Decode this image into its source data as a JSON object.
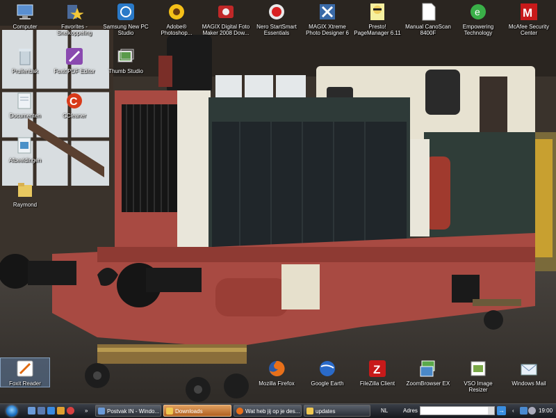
{
  "desktop_icons": [
    {
      "label": "Computer",
      "icon": "computer-icon"
    },
    {
      "label": "Favorites - Snelkoppeling",
      "icon": "favorites-star-icon"
    },
    {
      "label": "Samsung New PC Studio",
      "icon": "samsung-pc-studio-icon"
    },
    {
      "label": "Adobe® Photoshop...",
      "icon": "photoshop-sunflower-icon"
    },
    {
      "label": "MAGIX Digital Foto Maker 2008 Dow...",
      "icon": "magix-foto-maker-icon"
    },
    {
      "label": "Nero StartSmart Essentials",
      "icon": "nero-icon"
    },
    {
      "label": "MAGIX Xtreme Photo Designer 6",
      "icon": "magix-photo-designer-icon"
    },
    {
      "label": "Presto! PageManager 6.11",
      "icon": "presto-pagemanager-icon"
    },
    {
      "label": "Manual CanoScan 8400F",
      "icon": "document-icon"
    },
    {
      "label": "Empowering Technology",
      "icon": "empowering-technology-icon"
    },
    {
      "label": "McAfee Security Center",
      "icon": "mcafee-icon"
    },
    {
      "label": "Prullenbak",
      "icon": "recycle-bin-icon"
    },
    {
      "label": "Foxit PDF Editor",
      "icon": "foxit-pdf-editor-icon"
    },
    {
      "label": "Thumb Studio",
      "icon": "thumb-studio-icon"
    },
    {
      "label": "Documenten",
      "icon": "documents-folder-icon"
    },
    {
      "label": "CCleaner",
      "icon": "ccleaner-icon"
    },
    {
      "label": "Afbeeldingen",
      "icon": "pictures-folder-icon"
    },
    {
      "label": "Raymond",
      "icon": "user-folder-icon"
    },
    {
      "label": "Foxit Reader",
      "icon": "foxit-reader-icon"
    },
    {
      "label": "Mozilla Firefox",
      "icon": "firefox-icon"
    },
    {
      "label": "Google Earth",
      "icon": "google-earth-icon"
    },
    {
      "label": "FileZilla Client",
      "icon": "filezilla-icon"
    },
    {
      "label": "ZoomBrowser EX",
      "icon": "zoombrowser-icon"
    },
    {
      "label": "VSO Image Resizer",
      "icon": "vso-image-resizer-icon"
    },
    {
      "label": "Windows Mail",
      "icon": "windows-mail-icon"
    }
  ],
  "taskbar": {
    "quick_launch": [
      "show-desktop-icon",
      "switch-windows-icon",
      "ie-icon",
      "media-player-icon",
      "mail-icon",
      "firefox-icon"
    ],
    "overflow": "»",
    "buttons": [
      {
        "label": "Postvak IN - Windo...",
        "active": false
      },
      {
        "label": "Downloads",
        "active": true
      },
      {
        "label": "Wat heb jij op je des...",
        "active": false
      },
      {
        "label": "updates",
        "active": false
      }
    ],
    "language": "NL",
    "address_label": "Adres",
    "address_value": "",
    "go_glyph": "→",
    "tray_icons": [
      "network-icon",
      "volume-icon",
      "security-icon"
    ],
    "clock": "19:00"
  },
  "colors": {
    "taskbar": "#1d2127",
    "active_button": "#c97a33",
    "loco_body": "#2e3a38",
    "loco_frame": "#a84a42",
    "cab": "#e7e2d1"
  }
}
